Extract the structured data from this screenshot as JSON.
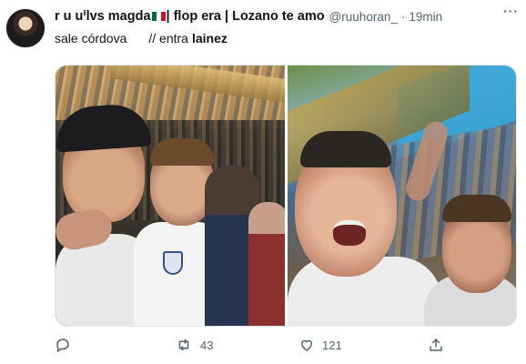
{
  "tweet": {
    "display_name": "r u uⁱlvs magda",
    "display_name_suffix": "| flop era | Lozano te amo",
    "handle": "@ruuhoran_",
    "dot": "·",
    "time": "19min",
    "more": "···",
    "text_part1": "sale córdova",
    "text_part2": "// entra",
    "text_bold": "lainez"
  },
  "actions": {
    "reply_count": "",
    "retweet_count": "43",
    "like_count": "121",
    "share_label": ""
  },
  "colors": {
    "secondary_text": "#536471",
    "primary_text": "#0f1419"
  },
  "icons": [
    "avatar",
    "flag-mexico-icon",
    "more-icon",
    "reply-icon",
    "retweet-icon",
    "like-icon",
    "share-icon"
  ]
}
